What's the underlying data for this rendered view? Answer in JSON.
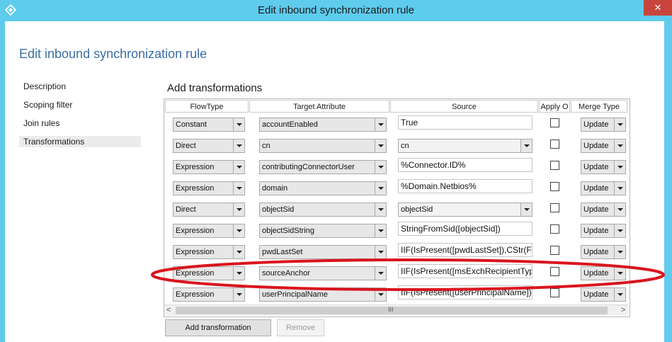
{
  "window": {
    "title": "Edit inbound synchronization rule",
    "close_glyph": "✕",
    "app_icon": "sync-diamond-icon"
  },
  "page": {
    "heading": "Edit inbound synchronization rule",
    "section_title": "Add transformations"
  },
  "nav": {
    "items": [
      {
        "label": "Description",
        "selected": false
      },
      {
        "label": "Scoping filter",
        "selected": false
      },
      {
        "label": "Join rules",
        "selected": false
      },
      {
        "label": "Transformations",
        "selected": true
      }
    ]
  },
  "grid": {
    "headers": [
      "FlowType",
      "Target Attribute",
      "Source",
      "Apply O",
      "Merge Type"
    ],
    "rows": [
      {
        "flow_type": "Constant",
        "target": "accountEnabled",
        "source": "True",
        "source_is_combo": false,
        "merge": "Update"
      },
      {
        "flow_type": "Direct",
        "target": "cn",
        "source": "cn",
        "source_is_combo": true,
        "merge": "Update"
      },
      {
        "flow_type": "Expression",
        "target": "contributingConnectorUser",
        "source": "%Connector.ID%",
        "source_is_combo": false,
        "merge": "Update"
      },
      {
        "flow_type": "Expression",
        "target": "domain",
        "source": "%Domain.Netbios%",
        "source_is_combo": false,
        "merge": "Update"
      },
      {
        "flow_type": "Direct",
        "target": "objectSid",
        "source": "objectSid",
        "source_is_combo": true,
        "merge": "Update"
      },
      {
        "flow_type": "Expression",
        "target": "objectSidString",
        "source": "StringFromSid([objectSid])",
        "source_is_combo": false,
        "merge": "Update"
      },
      {
        "flow_type": "Expression",
        "target": "pwdLastSet",
        "source": "IIF(IsPresent([pwdLastSet]),CStr(For",
        "source_is_combo": false,
        "merge": "Update"
      },
      {
        "flow_type": "Expression",
        "target": "sourceAnchor",
        "source": "IIF(IsPresent([msExchRecipientType",
        "source_is_combo": false,
        "merge": "Update"
      },
      {
        "flow_type": "Expression",
        "target": "userPrincipalName",
        "source": "IIF(IsPresent([userPrincipalName]),[u",
        "source_is_combo": false,
        "merge": "Update"
      }
    ],
    "scroll": {
      "left_glyph": "<",
      "right_glyph": ">",
      "grip_glyph": "III"
    }
  },
  "buttons": {
    "add_transformation": "Add transformation",
    "remove": "Remove"
  },
  "colors": {
    "titlebar": "#5fcbed",
    "heading": "#3a6ea5",
    "close": "#c7453e",
    "annotation": "#d9141e"
  }
}
